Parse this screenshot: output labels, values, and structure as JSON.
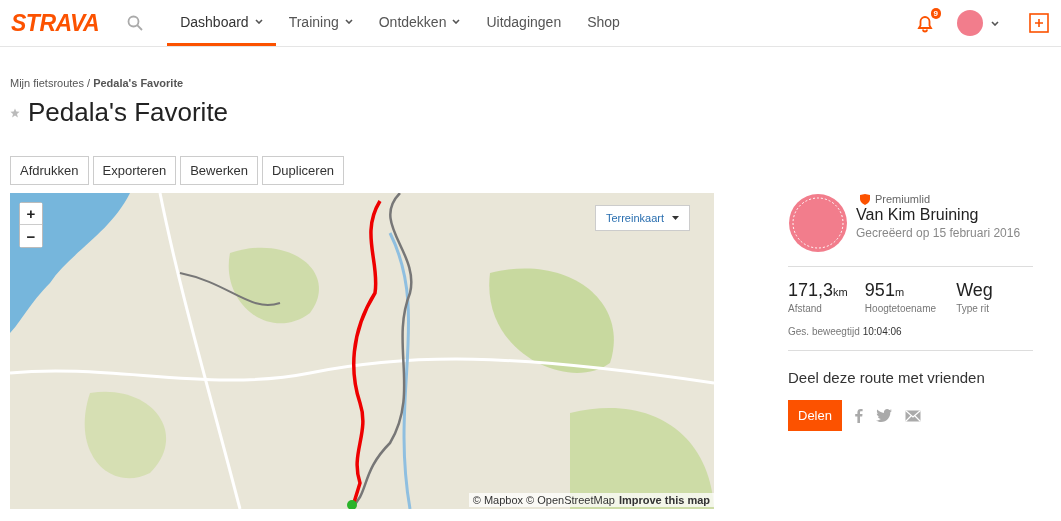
{
  "header": {
    "logo": "STRAVA",
    "nav": [
      {
        "label": "Dashboard",
        "selected": true,
        "dropdown": true
      },
      {
        "label": "Training",
        "selected": false,
        "dropdown": true
      },
      {
        "label": "Ontdekken",
        "selected": false,
        "dropdown": true
      },
      {
        "label": "Uitdagingen",
        "selected": false,
        "dropdown": false
      },
      {
        "label": "Shop",
        "selected": false,
        "dropdown": false
      }
    ],
    "notification_count": "9"
  },
  "breadcrumb": "Mijn fietsroutes / **Pedala's Favorite**",
  "title": "Pedala's Favorite",
  "starred": false,
  "actions": [
    "Afdrukken",
    "Exporteren",
    "Bewerken",
    "Dupliceren"
  ],
  "map": {
    "zoom_in": "+",
    "zoom_out": "−",
    "layer": "Terreinkaart",
    "attribution": "© Mapbox © OpenStreetMap",
    "improve_link": "Improve this map"
  },
  "athlete": {
    "badge": "Premiumlid",
    "name": "Van Kim Bruining",
    "created": "Gecreëerd op 15 februari 2016"
  },
  "stats": [
    {
      "value": "171,3",
      "unit": "km",
      "label": "Afstand"
    },
    {
      "value": "951",
      "unit": "m",
      "label": "Hoogtetoename"
    },
    {
      "value": "Weg",
      "label": "Type rit"
    }
  ],
  "moving_time": {
    "label": "Ges. beweegtijd",
    "value": "10:04:06"
  },
  "share": {
    "heading": "Deel deze route met vrienden",
    "button": "Delen"
  }
}
